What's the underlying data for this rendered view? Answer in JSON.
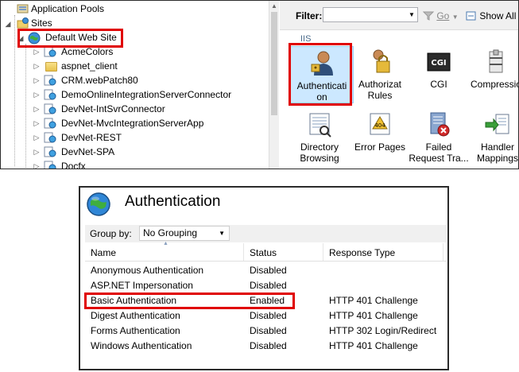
{
  "tree": {
    "items": [
      {
        "label": "Application Pools",
        "icon": "app-pools-icon",
        "type": "pools"
      },
      {
        "label": "Sites",
        "icon": "sites-folder-icon",
        "type": "sites"
      },
      {
        "label": "Default Web Site",
        "icon": "globe-icon",
        "type": "site"
      },
      {
        "label": "AcmeColors",
        "icon": "web-app-icon",
        "type": "app"
      },
      {
        "label": "aspnet_client",
        "icon": "folder-icon",
        "type": "folder"
      },
      {
        "label": "CRM.webPatch80",
        "icon": "web-app-icon",
        "type": "app"
      },
      {
        "label": "DemoOnlineIntegrationServerConnector",
        "icon": "web-app-icon",
        "type": "app"
      },
      {
        "label": "DevNet-IntSvrConnector",
        "icon": "web-app-icon",
        "type": "app"
      },
      {
        "label": "DevNet-MvcIntegrationServerApp",
        "icon": "web-app-icon",
        "type": "app"
      },
      {
        "label": "DevNet-REST",
        "icon": "web-app-icon",
        "type": "app"
      },
      {
        "label": "DevNet-SPA",
        "icon": "web-app-icon",
        "type": "app"
      },
      {
        "label": "Docfx",
        "icon": "web-app-icon",
        "type": "app"
      }
    ]
  },
  "filterbar": {
    "filter_label": "Filter:",
    "go_label": "Go",
    "show_all_label": "Show All"
  },
  "features": {
    "group_label": "IIS",
    "items": [
      {
        "lines": [
          "Authenticati",
          "on"
        ],
        "icon": "authentication-icon"
      },
      {
        "lines": [
          "Authorizat",
          "Rules"
        ],
        "icon": "authorization-rules-icon"
      },
      {
        "lines": [
          "CGI"
        ],
        "icon": "cgi-icon"
      },
      {
        "lines": [
          "Compressio"
        ],
        "icon": "compression-icon"
      },
      {
        "lines": [
          "Directory",
          "Browsing"
        ],
        "icon": "directory-browsing-icon"
      },
      {
        "lines": [
          "Error Pages"
        ],
        "icon": "error-pages-icon"
      },
      {
        "lines": [
          "Failed",
          "Request Tra..."
        ],
        "icon": "failed-request-tracing-icon"
      },
      {
        "lines": [
          "Handler",
          "Mappings"
        ],
        "icon": "handler-mappings-icon"
      }
    ]
  },
  "auth": {
    "title": "Authentication",
    "group_by_label": "Group by:",
    "group_by_value": "No Grouping",
    "columns": [
      "Name",
      "Status",
      "Response Type"
    ],
    "rows": [
      {
        "name": "Anonymous Authentication",
        "status": "Disabled",
        "response": ""
      },
      {
        "name": "ASP.NET Impersonation",
        "status": "Disabled",
        "response": ""
      },
      {
        "name": "Basic Authentication",
        "status": "Enabled",
        "response": "HTTP 401 Challenge"
      },
      {
        "name": "Digest Authentication",
        "status": "Disabled",
        "response": "HTTP 401 Challenge"
      },
      {
        "name": "Forms Authentication",
        "status": "Disabled",
        "response": "HTTP 302 Login/Redirect"
      },
      {
        "name": "Windows Authentication",
        "status": "Disabled",
        "response": "HTTP 401 Challenge"
      }
    ]
  },
  "colors": {
    "highlight_box": "#e00000",
    "selected_feature_bg": "#cce8ff",
    "selected_feature_border": "#99d1ff"
  }
}
